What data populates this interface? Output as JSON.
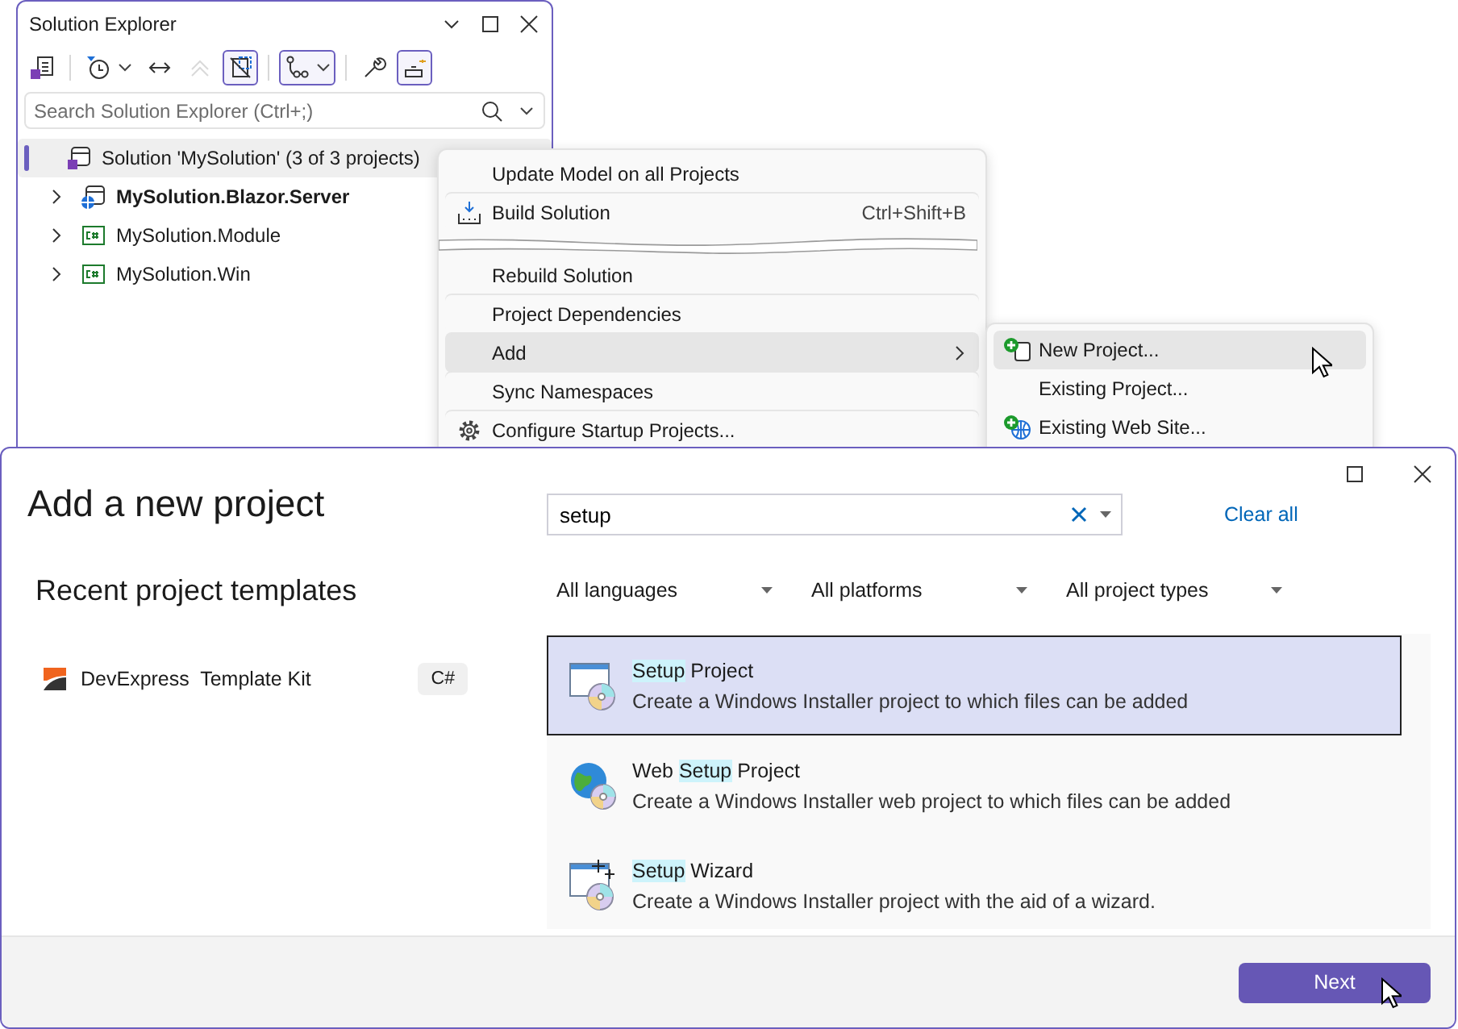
{
  "solution_explorer": {
    "title": "Solution Explorer",
    "toolbar": [
      {
        "kind": "solution",
        "pressed": false,
        "disabled": false,
        "dropdown": false
      },
      {
        "kind": "history",
        "pressed": false,
        "disabled": false,
        "dropdown": true
      },
      {
        "kind": "sync",
        "pressed": false,
        "disabled": false,
        "dropdown": false
      },
      {
        "kind": "collapse",
        "pressed": false,
        "disabled": true,
        "dropdown": false
      },
      {
        "kind": "files",
        "pressed": true,
        "disabled": false,
        "dropdown": false
      },
      {
        "kind": "tree",
        "pressed": true,
        "disabled": false,
        "dropdown": true
      },
      {
        "kind": "wrench",
        "pressed": false,
        "disabled": false,
        "dropdown": false
      },
      {
        "kind": "preview",
        "pressed": true,
        "disabled": false,
        "dropdown": false
      }
    ],
    "search": {
      "placeholder": "Search Solution Explorer (Ctrl+;)"
    },
    "tree": [
      {
        "label": "Solution 'MySolution' (3 of 3 projects)",
        "kind": "solution",
        "selected": true,
        "bold": false,
        "children": [
          {
            "label": "MySolution.Blazor.Server",
            "kind": "web",
            "selected": false,
            "bold": true,
            "expanded": false
          },
          {
            "label": "MySolution.Module",
            "kind": "csharp",
            "selected": false,
            "bold": false,
            "expanded": false
          },
          {
            "label": "MySolution.Win",
            "kind": "csharp",
            "selected": false,
            "bold": false,
            "expanded": false
          }
        ]
      }
    ]
  },
  "context_menu": {
    "items": [
      {
        "label": "Update Model on all Projects",
        "kind": "plain",
        "highlighted": false,
        "submenu": false
      },
      {
        "label": "Build Solution",
        "kind": "build",
        "shortcut": "Ctrl+Shift+B",
        "highlighted": false,
        "submenu": false,
        "torn_after": true
      },
      {
        "label": "Rebuild Solution",
        "kind": "plain",
        "highlighted": false,
        "submenu": false
      },
      {
        "label": "Project Dependencies",
        "kind": "plain",
        "highlighted": false,
        "submenu": false
      },
      {
        "label": "Add",
        "kind": "plain",
        "highlighted": true,
        "submenu": true
      },
      {
        "label": "Sync Namespaces",
        "kind": "plain",
        "highlighted": false,
        "submenu": false
      },
      {
        "label": "Configure Startup Projects...",
        "kind": "gear",
        "highlighted": false,
        "submenu": false
      }
    ]
  },
  "submenu": {
    "items": [
      {
        "label": "New Project...",
        "kind": "new-project",
        "highlighted": true
      },
      {
        "label": "Existing Project...",
        "kind": "plain",
        "highlighted": false
      },
      {
        "label": "Existing Web Site...",
        "kind": "web-site",
        "highlighted": false
      }
    ]
  },
  "dialog": {
    "title": "Add a new project",
    "recent_heading": "Recent project templates",
    "recent": [
      {
        "name": "DevExpress  Template Kit",
        "language": "C#"
      }
    ],
    "search": {
      "value": "setup"
    },
    "clear_all": "Clear all",
    "filters": [
      "All languages",
      "All platforms",
      "All project types"
    ],
    "templates": [
      {
        "kind": "setup",
        "selected": true,
        "title": "Setup Project",
        "description": "Create a Windows Installer project to which files can be added"
      },
      {
        "kind": "web-setup",
        "selected": false,
        "title": "Web Setup Project",
        "description": "Create a Windows Installer web project to which files can be added"
      },
      {
        "kind": "wizard",
        "selected": false,
        "title": "Setup Wizard",
        "description": "Create a Windows Installer project with the aid of a wizard."
      }
    ],
    "next_button": "Next"
  }
}
